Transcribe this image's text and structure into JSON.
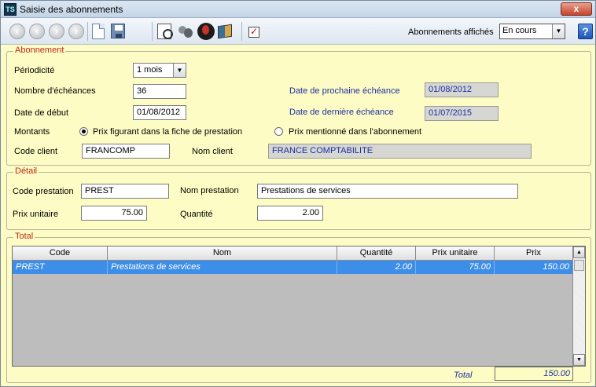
{
  "window": {
    "title": "Saisie des abonnements",
    "close_label": "x",
    "app_icon_text": "TS"
  },
  "toolbar": {
    "abonnements_label": "Abonnements affichés",
    "abonnements_value": "En cours",
    "help_label": "?"
  },
  "abonnement": {
    "legend": "Abonnement",
    "periodicite_label": "Périodicité",
    "periodicite_value": "1 mois",
    "nb_echeances_label": "Nombre d'échéances",
    "nb_echeances_value": "36",
    "date_debut_label": "Date de début",
    "date_debut_value": "01/08/2012",
    "prochaine_label": "Date de prochaine échéance",
    "prochaine_value": "01/08/2012",
    "derniere_label": "Date de dernière échéance",
    "derniere_value": "01/07/2015",
    "montants_label": "Montants",
    "radio1_label": "Prix figurant dans la fiche de prestation",
    "radio2_label": "Prix mentionné dans l'abonnement",
    "radio_selected": "radio1",
    "code_client_label": "Code client",
    "code_client_value": "FRANCOMP",
    "nom_client_label": "Nom client",
    "nom_client_value": "FRANCE COMPTABILITE"
  },
  "detail": {
    "legend": "Détail",
    "code_prestation_label": "Code prestation",
    "code_prestation_value": "PREST",
    "nom_prestation_label": "Nom prestation",
    "nom_prestation_value": "Prestations de services",
    "prix_unitaire_label": "Prix unitaire",
    "prix_unitaire_value": "75.00",
    "quantite_label": "Quantité",
    "quantite_value": "2.00"
  },
  "total": {
    "legend": "Total",
    "columns": [
      "Code",
      "Nom",
      "Quantité",
      "Prix unitaire",
      "Prix"
    ],
    "rows": [
      [
        "PREST",
        "Prestations de services",
        "2.00",
        "75.00",
        "150.00"
      ]
    ],
    "total_label": "Total",
    "total_value": "150.00"
  },
  "colors": {
    "background": "#fdfcc4",
    "legend": "#c0281e",
    "link_text": "#1b2fa0",
    "selected_row": "#3d8ee8"
  }
}
